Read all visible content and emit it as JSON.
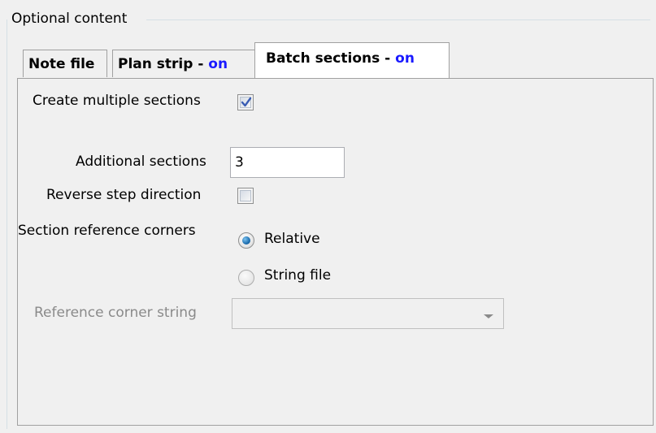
{
  "group": {
    "title": "Optional content"
  },
  "tabs": [
    {
      "label": "Note file",
      "status": ""
    },
    {
      "label": "Plan strip - ",
      "status": "on"
    },
    {
      "label": "Batch sections - ",
      "status": "on"
    }
  ],
  "form": {
    "create_multiple_label": "Create multiple sections",
    "create_multiple_checked": true,
    "additional_sections_label": "Additional sections",
    "additional_sections_value": "3",
    "reverse_step_label": "Reverse step direction",
    "reverse_step_checked": false,
    "section_ref_label": "Section reference corners",
    "radio_relative_label": "Relative",
    "radio_string_file_label": "String file",
    "selected_radio": "Relative",
    "ref_corner_string_label": "Reference corner string",
    "ref_corner_string_value": ""
  },
  "colors": {
    "on_text": "#1a1aff",
    "background": "#f0f0f0"
  }
}
